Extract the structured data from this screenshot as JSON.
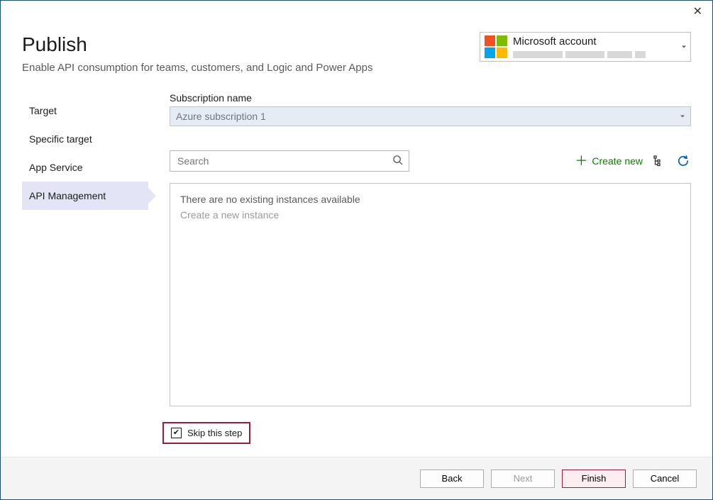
{
  "dialog": {
    "title": "Publish",
    "subtitle": "Enable API consumption for teams, customers, and Logic and Power Apps"
  },
  "account": {
    "provider": "Microsoft account"
  },
  "sidebar": {
    "items": [
      {
        "label": "Target",
        "active": false
      },
      {
        "label": "Specific target",
        "active": false
      },
      {
        "label": "App Service",
        "active": false
      },
      {
        "label": "API Management",
        "active": true
      }
    ]
  },
  "main": {
    "subscription_label": "Subscription name",
    "subscription_value": "Azure subscription 1",
    "search_placeholder": "Search",
    "create_new_label": "Create new",
    "empty_line1": "There are no existing instances available",
    "empty_line2": "Create a new instance",
    "skip_label": "Skip this step",
    "skip_checked": true
  },
  "footer": {
    "back": "Back",
    "next": "Next",
    "finish": "Finish",
    "cancel": "Cancel"
  }
}
